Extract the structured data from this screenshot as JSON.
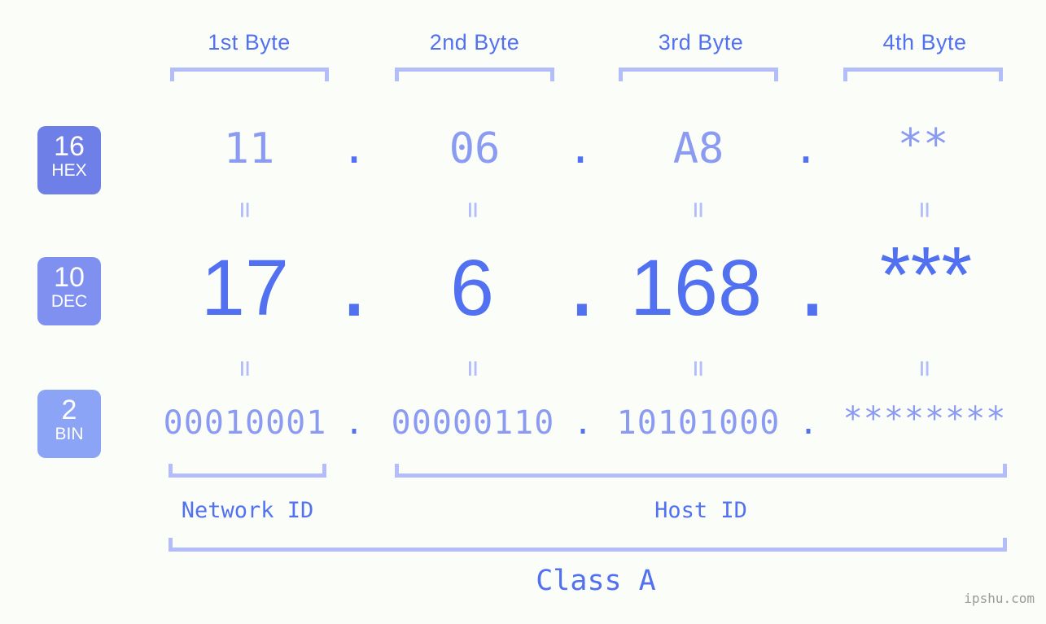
{
  "page": {
    "background_color": "#fbfdf9",
    "accent_color": "#5271f0",
    "muted_accent_color": "#8b9bf2",
    "bracket_color": "#b3bdfa",
    "watermark": "ipshu.com"
  },
  "byte_headers": [
    {
      "label": "1st Byte"
    },
    {
      "label": "2nd Byte"
    },
    {
      "label": "3rd Byte"
    },
    {
      "label": "4th Byte"
    }
  ],
  "bases": [
    {
      "number": "16",
      "abbr": "HEX",
      "color": "#6f7fe8"
    },
    {
      "number": "10",
      "abbr": "DEC",
      "color": "#8090f0"
    },
    {
      "number": "2",
      "abbr": "BIN",
      "color": "#8ba4f5"
    }
  ],
  "rows": {
    "hex": {
      "values": [
        "11",
        "06",
        "A8",
        "**"
      ],
      "separators": [
        ".",
        ".",
        "."
      ]
    },
    "dec": {
      "values": [
        "17",
        "6",
        "168",
        "***"
      ],
      "separators": [
        ".",
        ".",
        "."
      ]
    },
    "bin": {
      "values": [
        "00010001",
        "00000110",
        "10101000",
        "********"
      ],
      "separators": [
        ".",
        ".",
        "."
      ]
    }
  },
  "equals_separator": "=",
  "segments": {
    "network_id": "Network ID",
    "host_id": "Host ID",
    "class": "Class A"
  }
}
